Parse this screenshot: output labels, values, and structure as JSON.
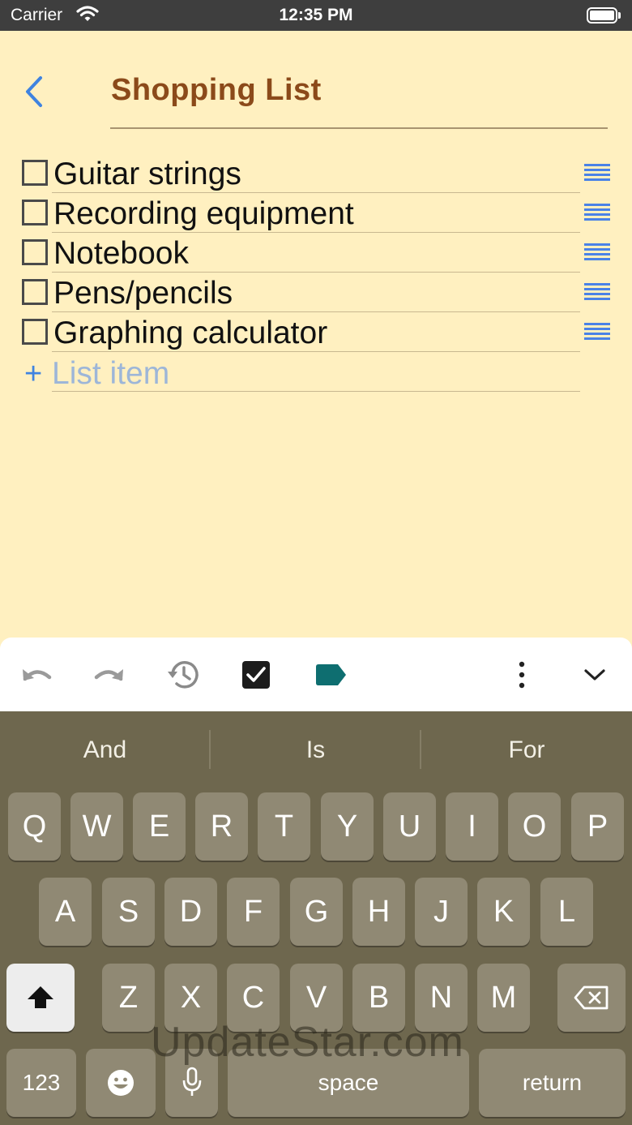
{
  "status_bar": {
    "carrier": "Carrier",
    "time": "12:35 PM"
  },
  "header": {
    "title": "Shopping List"
  },
  "list": {
    "items": [
      {
        "label": "Guitar strings",
        "checked": false
      },
      {
        "label": "Recording equipment",
        "checked": false
      },
      {
        "label": "Notebook",
        "checked": false
      },
      {
        "label": "Pens/pencils",
        "checked": false
      },
      {
        "label": "Graphing calculator",
        "checked": false
      }
    ],
    "add_placeholder": "List item"
  },
  "toolbar": {
    "icons": [
      "undo-icon",
      "redo-icon",
      "history-icon",
      "checkbox-toggle-icon",
      "label-tag-icon",
      "more-vertical-icon",
      "chevron-down-icon"
    ],
    "accent_color": "#0E6E70"
  },
  "keyboard": {
    "suggestions": [
      "And",
      "Is",
      "For"
    ],
    "row1": [
      "Q",
      "W",
      "E",
      "R",
      "T",
      "Y",
      "U",
      "I",
      "O",
      "P"
    ],
    "row2": [
      "A",
      "S",
      "D",
      "F",
      "G",
      "H",
      "J",
      "K",
      "L"
    ],
    "row3": [
      "Z",
      "X",
      "C",
      "V",
      "B",
      "N",
      "M"
    ],
    "numbers_label": "123",
    "space_label": "space",
    "return_label": "return"
  },
  "watermark": "UpdateStar.com",
  "colors": {
    "background": "#FFF0C0",
    "title": "#8B4A1A",
    "accent_blue": "#3F83E0",
    "keyboard": "#6E674E"
  }
}
